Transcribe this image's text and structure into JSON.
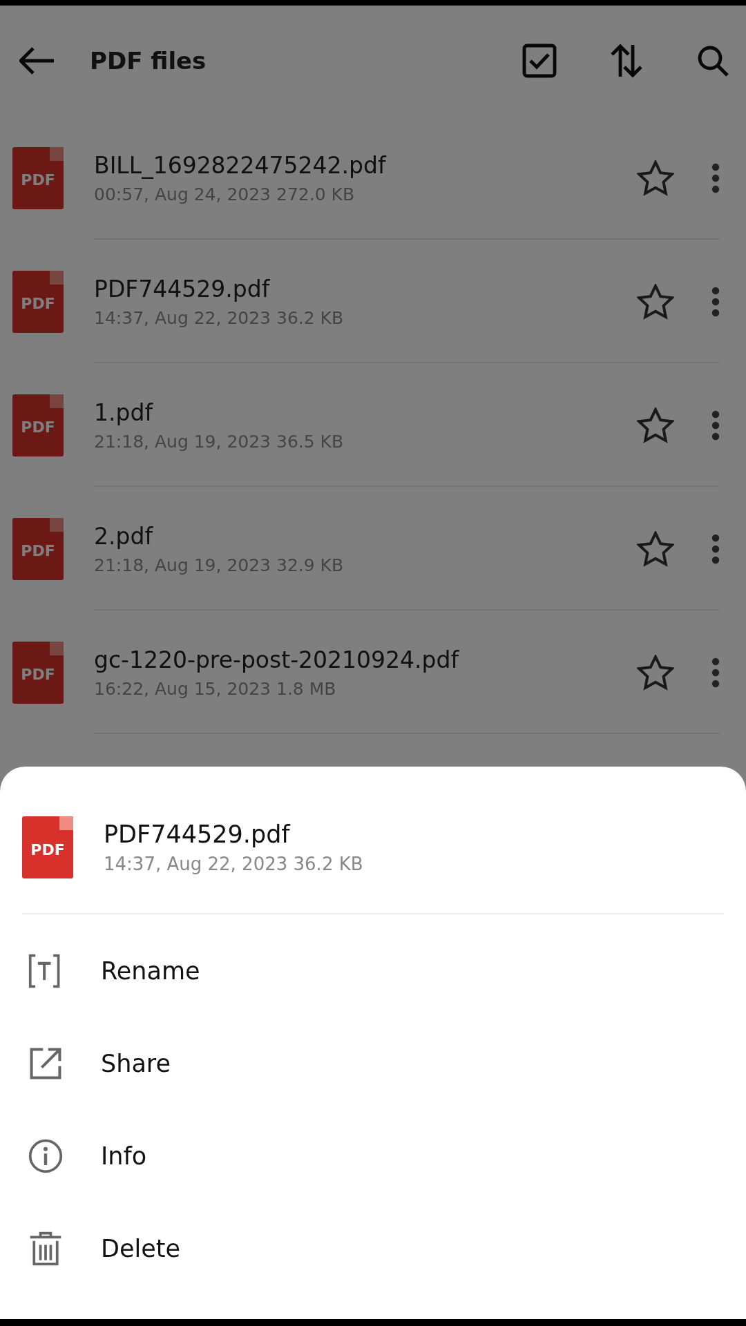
{
  "header": {
    "title": "PDF files"
  },
  "files": [
    {
      "icon_label": "PDF",
      "name": "BILL_1692822475242.pdf",
      "meta": "00:57, Aug 24, 2023 272.0 KB",
      "starred": false
    },
    {
      "icon_label": "PDF",
      "name": "PDF744529.pdf",
      "meta": "14:37, Aug 22, 2023 36.2 KB",
      "starred": false
    },
    {
      "icon_label": "PDF",
      "name": "1.pdf",
      "meta": "21:18, Aug 19, 2023 36.5 KB",
      "starred": false
    },
    {
      "icon_label": "PDF",
      "name": "2.pdf",
      "meta": "21:18, Aug 19, 2023 32.9 KB",
      "starred": false
    },
    {
      "icon_label": "PDF",
      "name": "gc-1220-pre-post-20210924.pdf",
      "meta": "16:22, Aug 15, 2023 1.8 MB",
      "starred": false
    }
  ],
  "sheet": {
    "file": {
      "icon_label": "PDF",
      "name": "PDF744529.pdf",
      "meta": "14:37, Aug 22, 2023 36.2 KB"
    },
    "actions": [
      {
        "kind": "rename",
        "label": "Rename"
      },
      {
        "kind": "share",
        "label": "Share"
      },
      {
        "kind": "info",
        "label": "Info"
      },
      {
        "kind": "delete",
        "label": "Delete"
      }
    ]
  }
}
